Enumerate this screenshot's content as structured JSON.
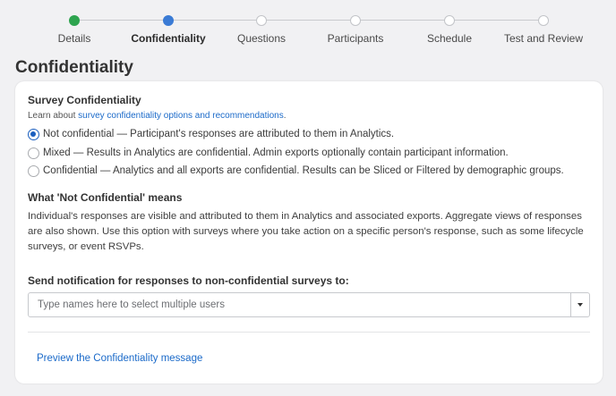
{
  "stepper": {
    "steps": [
      {
        "label": "Details",
        "state": "done"
      },
      {
        "label": "Confidentiality",
        "state": "current"
      },
      {
        "label": "Questions",
        "state": "upcoming"
      },
      {
        "label": "Participants",
        "state": "upcoming"
      },
      {
        "label": "Schedule",
        "state": "upcoming"
      },
      {
        "label": "Test and Review",
        "state": "upcoming"
      }
    ]
  },
  "page": {
    "title": "Confidentiality"
  },
  "survey": {
    "title": "Survey Confidentiality",
    "learn_prefix": "Learn about ",
    "learn_link": "survey confidentiality options and recommendations",
    "learn_suffix": ".",
    "options": [
      {
        "label": "Not confidential — Participant's responses are attributed to them in Analytics.",
        "selected": true
      },
      {
        "label": "Mixed — Results in Analytics are confidential. Admin exports optionally contain participant information.",
        "selected": false
      },
      {
        "label": "Confidential — Analytics and all exports are confidential. Results can be Sliced or Filtered by demographic groups.",
        "selected": false
      }
    ]
  },
  "meaning": {
    "title": "What 'Not Confidential' means",
    "text": "Individual's responses are visible and attributed to them in Analytics and associated exports. Aggregate views of responses are also shown. Use this option with surveys where you take action on a specific person's response, such as some lifecycle surveys, or event RSVPs."
  },
  "notification": {
    "title": "Send notification for responses to non-confidential surveys to:",
    "placeholder": "Type names here to select multiple users",
    "value": ""
  },
  "preview": {
    "label": "Preview the Confidentiality message"
  },
  "colors": {
    "done": "#2ea44f",
    "current": "#3a7bd5",
    "link": "#1b6ac9"
  },
  "icons": {
    "dropdown": "chevron-down-icon"
  }
}
